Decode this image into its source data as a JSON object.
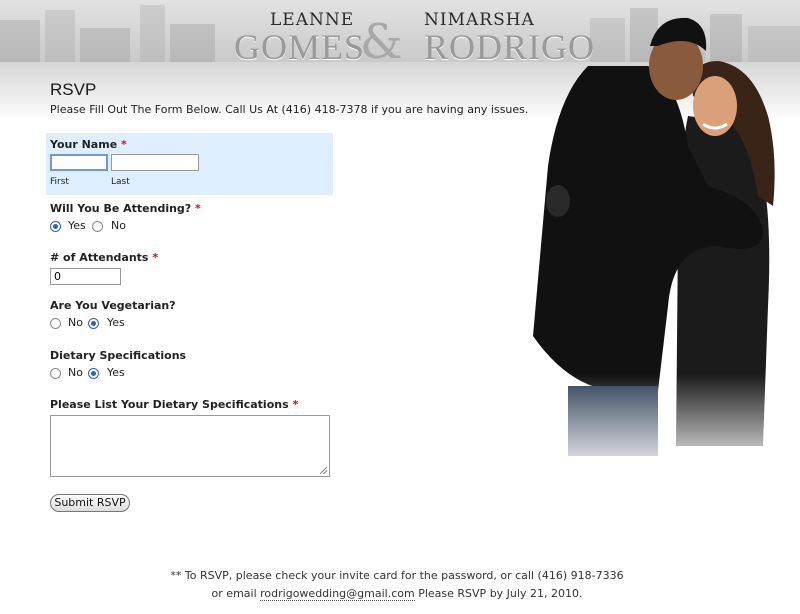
{
  "header": {
    "bride_first": "LEANNE",
    "bride_last": "GOMES",
    "ampersand": "&",
    "groom_first": "NIMARSHA",
    "groom_last": "RODRIGO"
  },
  "form": {
    "title": "RSVP",
    "intro": "Please Fill Out The Form Below. Call Us At (416) 418-7378 if you are having any issues.",
    "name": {
      "label": "Your Name",
      "required_mark": "*",
      "first_value": "",
      "last_value": "",
      "first_sublabel": "First",
      "last_sublabel": "Last"
    },
    "attending": {
      "label": "Will You Be Attending?",
      "required_mark": "*",
      "options": [
        "Yes",
        "No"
      ],
      "selected": "Yes"
    },
    "attendants": {
      "label": "# of Attendants",
      "required_mark": "*",
      "value": "0"
    },
    "vegetarian": {
      "label": "Are You Vegetarian?",
      "options": [
        "No",
        "Yes"
      ],
      "selected": "Yes"
    },
    "dietary_specs": {
      "label": "Dietary Specifications",
      "options": [
        "No",
        "Yes"
      ],
      "selected": "Yes"
    },
    "dietary_list": {
      "label": "Please List Your Dietary Specifications",
      "required_mark": "*",
      "value": ""
    },
    "submit_label": "Submit RSVP"
  },
  "footer": {
    "line1": "** To RSVP, please check your invite card for the password, or call (416) 918-7336",
    "line2_prefix": "or email",
    "email": "rodrigowedding@gmail.com",
    "line2_suffix": "Please RSVP by July 21, 2010."
  },
  "colors": {
    "accent": "#2b64b4",
    "required": "#cc1111",
    "name_block_bg": "#dfeeff"
  }
}
